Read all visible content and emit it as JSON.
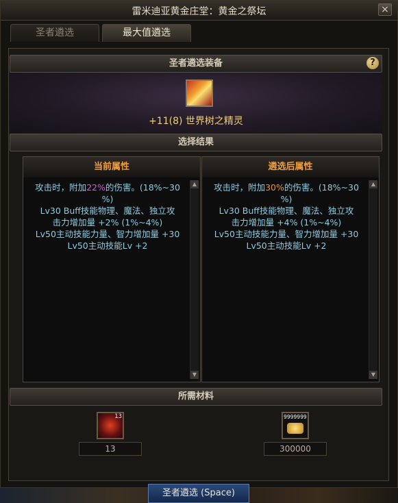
{
  "window": {
    "title": "雷米迪亚黄金庄堂：黄金之祭坛",
    "close_label": "×"
  },
  "tabs": [
    {
      "label": "圣者遴选",
      "active": false
    },
    {
      "label": "最大值遴选",
      "active": true
    }
  ],
  "sections": {
    "equipment_header": "圣者遴选装备",
    "help_label": "?",
    "result_header": "选择结果",
    "materials_header": "所需材料"
  },
  "equipment": {
    "name": "+11(8) 世界树之精灵",
    "icon": "flame-staff-icon"
  },
  "current_attributes": {
    "header": "当前属性",
    "lines": [
      {
        "pre": "攻击时，附加",
        "value": "22%",
        "post": "的伤害。(18%~30"
      },
      {
        "pre": "%)",
        "value": "",
        "post": ""
      },
      {
        "pre": "Lv30 Buff技能物理、魔法、独立攻",
        "value": "",
        "post": ""
      },
      {
        "pre": "击力增加量 +2% (1%~4%)",
        "value": "",
        "post": ""
      },
      {
        "pre": "Lv50主动技能力量、智力增加量 +30",
        "value": "",
        "post": ""
      },
      {
        "pre": "Lv50主动技能Lv +2",
        "value": "",
        "post": ""
      }
    ]
  },
  "selected_attributes": {
    "header": "遴选后属性",
    "lines": [
      {
        "pre": "攻击时，附加",
        "value": "30%",
        "post": "的伤害。(18%~30"
      },
      {
        "pre": "%)",
        "value": "",
        "post": ""
      },
      {
        "pre": "Lv30 Buff技能物理、魔法、独立攻",
        "value": "",
        "post": ""
      },
      {
        "pre": "击力增加量 +4% (1%~4%)",
        "value": "",
        "post": ""
      },
      {
        "pre": "Lv50主动技能力量、智力增加量 +30",
        "value": "",
        "post": ""
      },
      {
        "pre": "Lv50主动技能Lv +2",
        "value": "",
        "post": ""
      }
    ]
  },
  "materials": [
    {
      "icon": "red-orb-icon",
      "badge": "13",
      "amount": "13"
    },
    {
      "icon": "gold-coins-icon",
      "badge": "9999999",
      "amount": "300000"
    }
  ],
  "confirm_button": "圣者遴选 (Space)",
  "scroll_up": "▲",
  "scroll_down": "▼"
}
